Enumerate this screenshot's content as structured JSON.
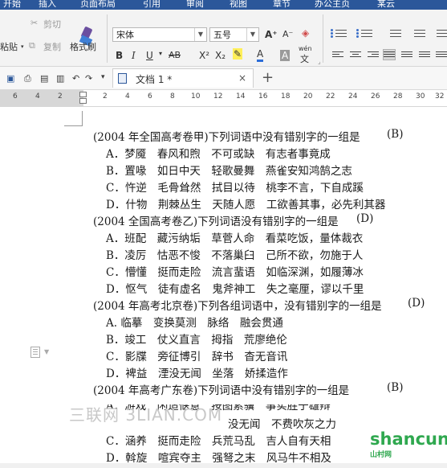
{
  "ribbon_tabs": [
    "开始",
    "插入",
    "页面布局",
    "引用",
    "审阅",
    "视图",
    "章节",
    "办公主页",
    "某云"
  ],
  "clipboard": {
    "paste": "粘贴",
    "cut": "剪切",
    "copy": "复制",
    "format_painter": "格式刷"
  },
  "font": {
    "name": "宋体",
    "size": "五号"
  },
  "format_buttons": {
    "bold": "B",
    "italic": "I",
    "underline": "U",
    "strike": "AB",
    "superscript": "X²",
    "subscript": "X₂",
    "grow": "A⁺",
    "shrink": "A⁻",
    "font_color": "A",
    "char_shade": "A",
    "phonetic": "wén"
  },
  "quick_access": {
    "dropdown": "▾"
  },
  "document_tab": {
    "name": "文档 1 *",
    "close": "×",
    "new_tab": "+"
  },
  "ruler": [
    "6",
    "4",
    "2",
    "2",
    "4",
    "6",
    "8",
    "10",
    "12",
    "14",
    "16",
    "18",
    "20",
    "22",
    "24",
    "26",
    "28",
    "30",
    "32"
  ],
  "document_lines": [
    "(2004 年全国高考卷甲)下列词语中没有错别字的一组是",
    "A．梦魇　春风和煦　不可或缺　有志者事竟成",
    "B．置喙　如日中天　轻歌曼舞　燕雀安知鸿鹄之志",
    "C．忤逆　毛骨耸然　拭目以待　桃李不言，下自成蹊",
    "D．什物　荆棘丛生　天随人愿　工欲善其事，必先利其器",
    "(2004 全国高考卷乙)下列词语没有错别字的一组是",
    "A．班配　藏污纳垢　草菅人命　看菜吃饭，量体裁衣",
    "B．凌厉　怙恶不悛　不落巢臼　己所不欲，勿施于人",
    "C．懵懂　挺而走险　流言蜚语　如临深渊，如履薄冰",
    "D．怄气　徒有虚名　鬼斧神工　失之毫厘，谬以千里",
    "(2004 年高考北京卷)下列各组词语中，没有错别字的一组是",
    "A. 临摹　变换莫测　脉络　融会贯通",
    "C．影牒　旁征博引　辞书　杳无音讯",
    "D．裨益　湮没无闻　坐落　娇揉造作",
    "(2004 年高考广东卷)下列词语中没有错别字的一组是",
    "C．涵养　挺而走险　兵荒马乱　吉人自有天相",
    "D．斡旋　喧宾夺主　强弩之末　风马牛不相及"
  ],
  "partial_lines": {
    "b_bj_start": "B．竣工　仗义直言　拇指　荒廖绝伦",
    "gd_a": "A．游戏　闲适惬意　按图索骥　事实胜于雄辩",
    "gd_b": "没无闻　不费吹灰之力"
  },
  "answers": [
    "(B)",
    "(D)",
    "(D)",
    "(B)"
  ],
  "watermarks": {
    "left": "三联网 3LIAN.COM",
    "right": "shancun",
    "right_small": "山村网"
  }
}
